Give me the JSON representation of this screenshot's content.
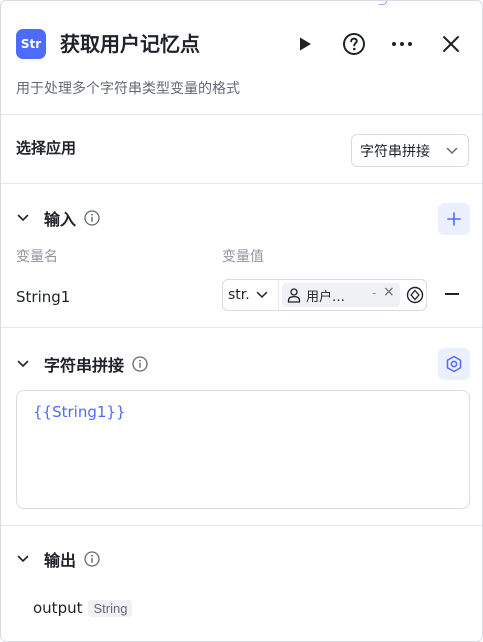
{
  "header": {
    "app_icon_text": "Str",
    "title": "获取用户记忆点",
    "description": "用于处理多个字符串类型变量的格式"
  },
  "select_app": {
    "label": "选择应用",
    "value": "字符串拼接"
  },
  "input_section": {
    "title": "输入",
    "col_name_label": "变量名",
    "col_value_label": "变量值",
    "rows": [
      {
        "name": "String1",
        "type": "str.",
        "ref_label": "用户…",
        "ref_dash": "-",
        "ref_clear": "×"
      }
    ]
  },
  "concat_section": {
    "title": "字符串拼接",
    "template": "{{String1}}"
  },
  "output_section": {
    "title": "输出",
    "name": "output",
    "type": "String"
  },
  "colors": {
    "accent": "#4d6bfe",
    "accent_bg": "#eceffd",
    "border": "#d9dbe0"
  },
  "icons": [
    "play-icon",
    "help-icon",
    "more-icon",
    "close-icon",
    "chevron-down-icon",
    "info-icon",
    "plus-icon",
    "user-icon",
    "variable-ref-icon",
    "minus-icon",
    "settings-icon"
  ]
}
